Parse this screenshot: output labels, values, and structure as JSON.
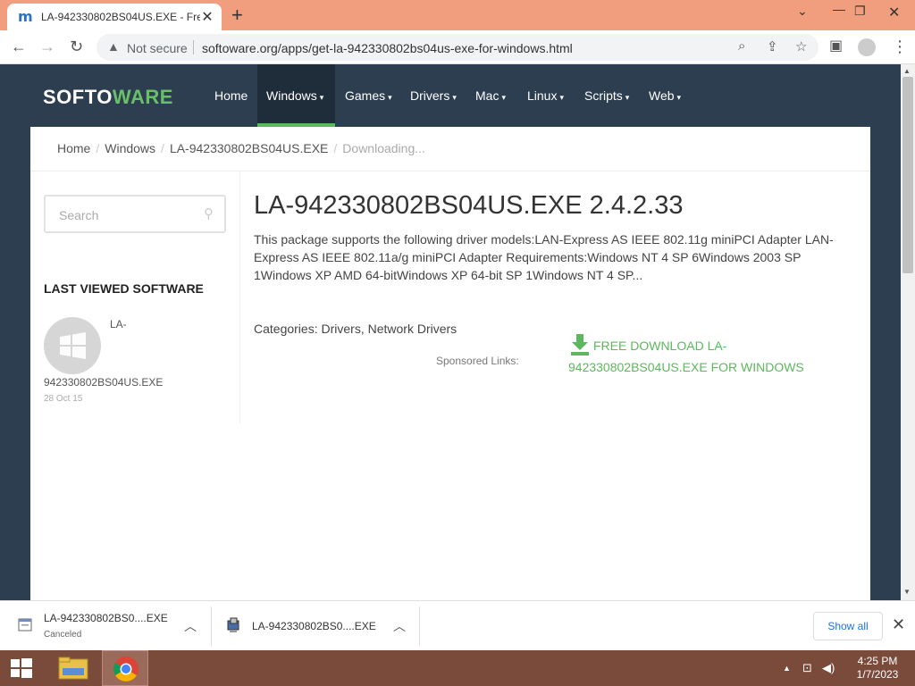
{
  "browser": {
    "tab_title": "LA-942330802BS04US.EXE - Free",
    "tab_favicon": "m",
    "not_secure": "Not secure",
    "url": "softoware.org/apps/get-la-942330802bs04us-exe-for-windows.html"
  },
  "site": {
    "logo_a": "SOFTO",
    "logo_b": "WARE",
    "nav": [
      {
        "label": "Home"
      },
      {
        "label": "Windows"
      },
      {
        "label": "Games"
      },
      {
        "label": "Drivers"
      },
      {
        "label": "Mac"
      },
      {
        "label": "Linux"
      },
      {
        "label": "Scripts"
      },
      {
        "label": "Web"
      }
    ],
    "caret": "▾"
  },
  "breadcrumb": {
    "items": [
      "Home",
      "Windows",
      "LA-942330802BS04US.EXE",
      "Downloading..."
    ],
    "sep": "/"
  },
  "sidebar": {
    "search_placeholder": "Search",
    "last_viewed_title": "LAST VIEWED SOFTWARE",
    "item_name_line1": "LA-",
    "item_name_line2": "942330802BS04US.EXE",
    "item_date": "28 Oct 15"
  },
  "main": {
    "title": "LA-942330802BS04US.EXE 2.4.2.33",
    "description": "This package supports the following driver models:LAN-Express AS IEEE 802.11g miniPCI Adapter LAN-Express AS IEEE 802.11a/g miniPCI Adapter Requirements:Windows NT 4 SP 6Windows 2003 SP 1Windows XP AMD 64-bitWindows XP 64-bit SP 1Windows NT 4 SP...",
    "categories": "Categories: Drivers, Network Drivers",
    "sponsored": "Sponsored Links:",
    "download_link": "FREE DOWNLOAD LA-942330802BS04US.EXE FOR WINDOWS",
    "accent_color": "#5cb85c"
  },
  "downloads": {
    "items": [
      {
        "name": "LA-942330802BS0....EXE",
        "status": "Canceled"
      },
      {
        "name": "LA-942330802BS0....EXE",
        "status": ""
      }
    ],
    "show_all": "Show all"
  },
  "taskbar": {
    "time": "4:25 PM",
    "date": "1/7/2023"
  },
  "colors": {
    "tab_strip": "#f09e7e",
    "site_header": "#2d3e50",
    "taskbar": "#7a4a3a"
  }
}
